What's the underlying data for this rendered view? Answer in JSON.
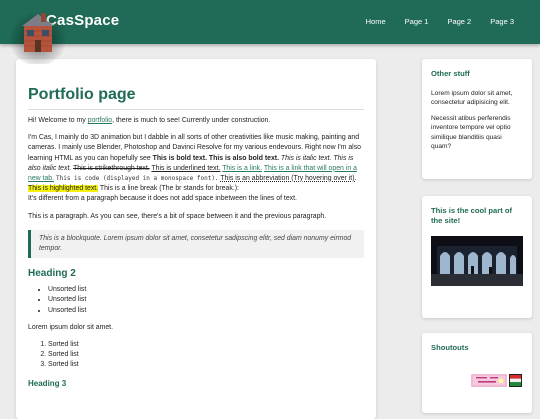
{
  "site": {
    "title": "CasSpace"
  },
  "nav": {
    "items": [
      {
        "label": "Home"
      },
      {
        "label": "Page 1"
      },
      {
        "label": "Page 2"
      },
      {
        "label": "Page 3"
      }
    ]
  },
  "main": {
    "title": "Portfolio page",
    "intro_before": "Hi! Welcome to my ",
    "intro_link": "portfolio",
    "intro_after": ", there is much to see! Currently under construction.",
    "p2_text": "I'm Cas, I mainly do 3D animation but I dabble in all sorts of other creativities like music making, painting and cameras. I mainly use Blender, Photoshop and Davinci Resolve for my various endevours. Right now I'm also learning HTML as you can hopefully see ",
    "bold1": "This is bold text.",
    "bold2": "This is also bold text.",
    "italic1": "This is italic text.",
    "italic2": "This is also italic text.",
    "strike": "This is strikethrough text.",
    "underline": "This is underlined text.",
    "link1": "This is a link.",
    "link2": "This is a link that will open in a new tab.",
    "code": "This is code (displayed in a monospace font).",
    "abbr": "This is an abbreviation (Try hovering over it).",
    "highlight": "This is highlighted text.",
    "linebreak": "This is a line break (The br stands for break.):",
    "after_break": "It's different from a paragraph because it does not add space inbetween the lines of text.",
    "p3": "This is a paragraph. As you can see, there's a bit of space between it and the previous paragraph.",
    "blockquote": "This is a blockquote. Lorem ipsum dolor sit amet, consetetur sadipscing elitr, sed diam nonumy eirmod tempor.",
    "h2": "Heading 2",
    "unsorted": [
      "Unsorted list",
      "Unsorted list",
      "Unsorted list"
    ],
    "lorem": "Lorem ipsum dolor sit amet.",
    "sorted": [
      "Sorted list",
      "Sorted list",
      "Sorted list"
    ],
    "h3": "Heading 3"
  },
  "sidebar": {
    "box1": {
      "title": "Other stuff",
      "p1": "Lorem ipsum dolor sit amet, consectetur adipisicing elit.",
      "p2": "Necessit atibus perferendis inventore tempore vel optio similique blanditiis quasi quam?"
    },
    "box2": {
      "title": "This is the cool part of the site!"
    },
    "box3": {
      "title": "Shoutouts"
    }
  },
  "colors": {
    "brand": "#1f6b57",
    "highlight": "#f6f20f",
    "background": "#ececec"
  }
}
